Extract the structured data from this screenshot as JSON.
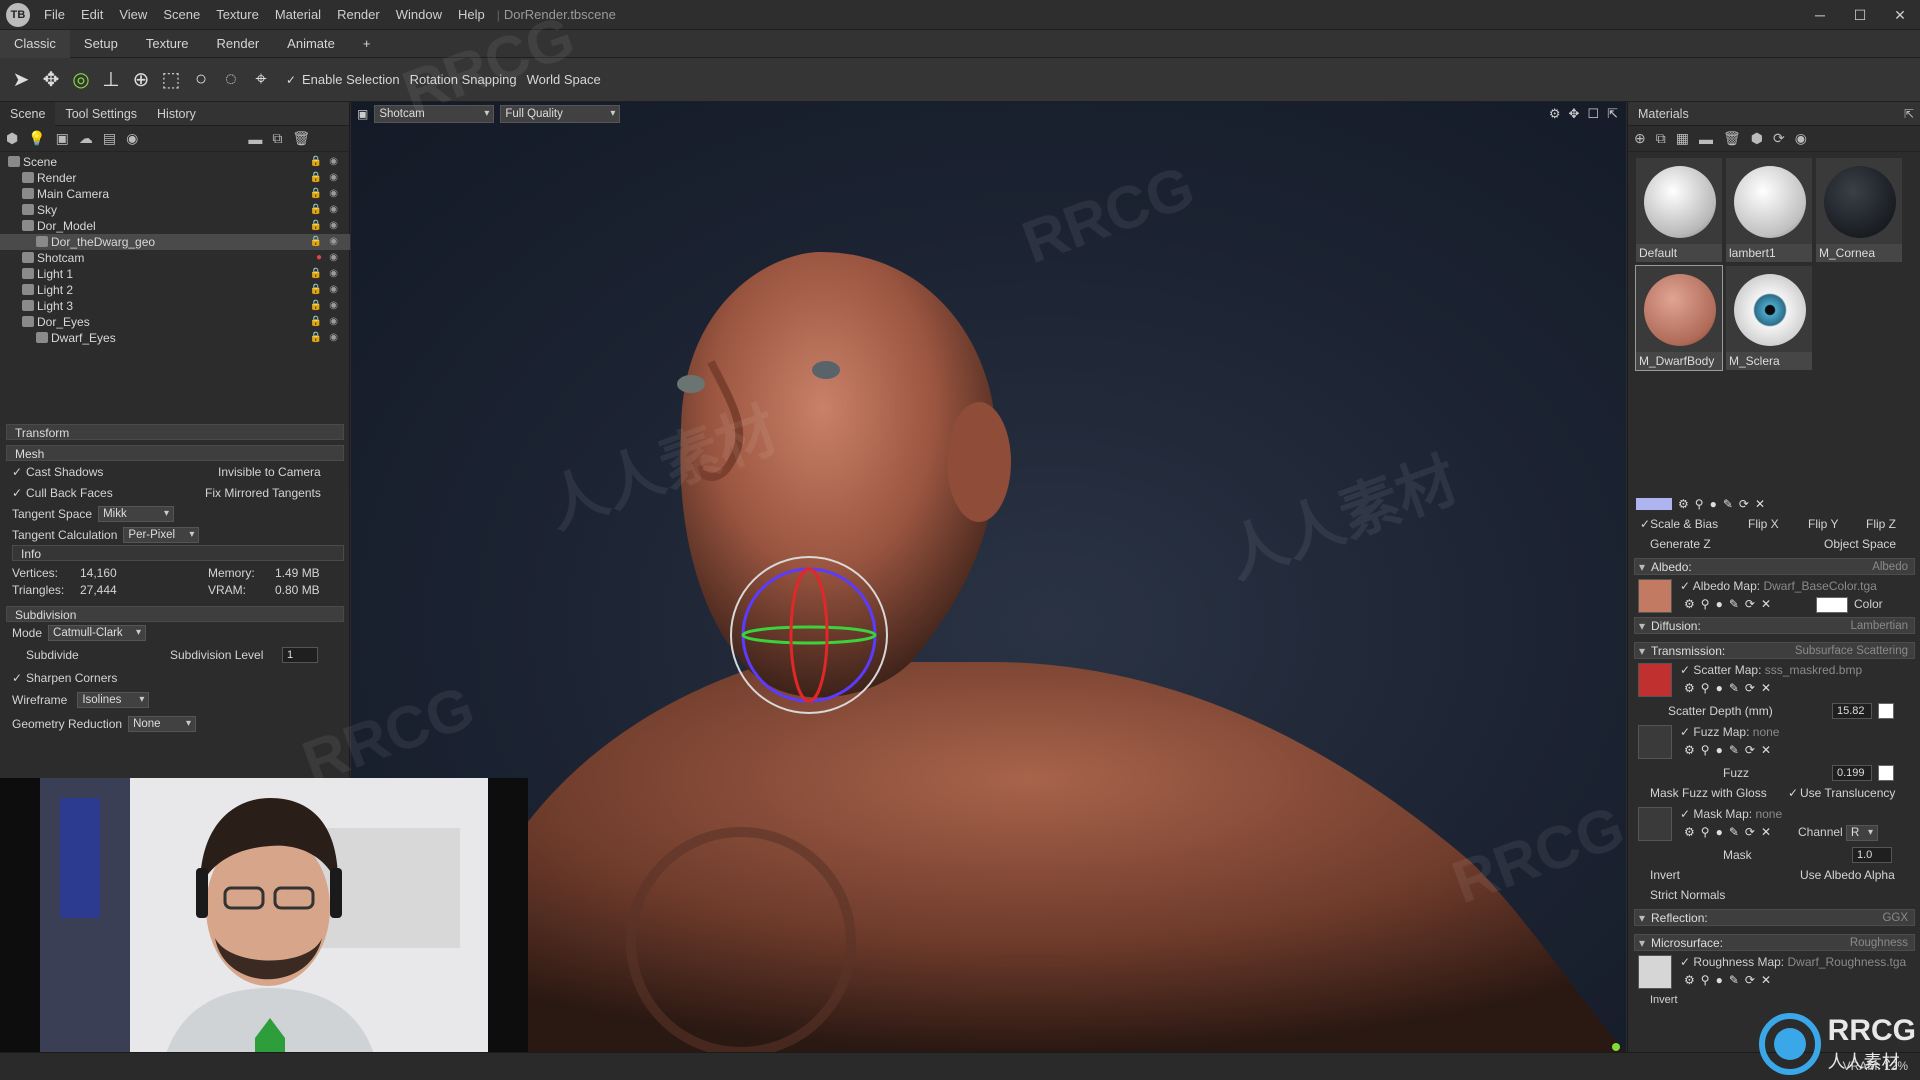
{
  "app": {
    "title": "DorRender.tbscene",
    "logo": "TB"
  },
  "menu": [
    "File",
    "Edit",
    "View",
    "Scene",
    "Texture",
    "Material",
    "Render",
    "Window",
    "Help"
  ],
  "window_controls": {
    "minimize": "─",
    "maximize": "☐",
    "close": "✕"
  },
  "workspace_tabs": [
    "Classic",
    "Setup",
    "Texture",
    "Render",
    "Animate",
    "+"
  ],
  "toolbar": {
    "enable_selection": "Enable Selection",
    "rotation_snapping": "Rotation Snapping",
    "world_space": "World Space",
    "icons": [
      "select-arrow-icon",
      "move-icon",
      "rotate-icon",
      "scale-icon",
      "cage-icon",
      "rect-select-icon",
      "circle-select-icon",
      "lasso-icon",
      "polygon-select-icon"
    ]
  },
  "scene_panel": {
    "tabs": [
      "Scene",
      "Tool Settings",
      "History"
    ],
    "tree": [
      {
        "label": "Scene",
        "indent": 0
      },
      {
        "label": "Render",
        "indent": 1
      },
      {
        "label": "Main Camera",
        "indent": 1
      },
      {
        "label": "Sky",
        "indent": 1
      },
      {
        "label": "Dor_Model",
        "indent": 1
      },
      {
        "label": "Dor_theDwarg_geo",
        "indent": 2,
        "selected": true
      },
      {
        "label": "Shotcam",
        "indent": 1,
        "locked": true
      },
      {
        "label": "Light 1",
        "indent": 1
      },
      {
        "label": "Light 2",
        "indent": 1
      },
      {
        "label": "Light 3",
        "indent": 1
      },
      {
        "label": "Dor_Eyes",
        "indent": 1
      },
      {
        "label": "Dwarf_Eyes",
        "indent": 2
      }
    ]
  },
  "properties": {
    "transform": "Transform",
    "mesh": "Mesh",
    "cast_shadows": "Cast Shadows",
    "invisible_to_camera": "Invisible to Camera",
    "cull_back_faces": "Cull Back Faces",
    "fix_mirrored_tangents": "Fix Mirrored Tangents",
    "tangent_space_label": "Tangent Space",
    "tangent_space_value": "Mikk",
    "tangent_calc_label": "Tangent Calculation",
    "tangent_calc_value": "Per-Pixel",
    "info": "Info",
    "vertices_label": "Vertices:",
    "vertices_value": "14,160",
    "triangles_label": "Triangles:",
    "triangles_value": "27,444",
    "memory_label": "Memory:",
    "memory_value": "1.49 MB",
    "vram_label": "VRAM:",
    "vram_value": "0.80 MB",
    "subdivision": "Subdivision",
    "mode_label": "Mode",
    "mode_value": "Catmull-Clark",
    "subdivide": "Subdivide",
    "subdivision_level_label": "Subdivision Level",
    "subdivision_level_value": "1",
    "sharpen_corners": "Sharpen Corners",
    "wireframe_label": "Wireframe",
    "wireframe_value": "Isolines",
    "geometry_reduction_label": "Geometry Reduction",
    "geometry_reduction_value": "None"
  },
  "viewport": {
    "camera": "Shotcam",
    "quality": "Full Quality"
  },
  "materials": {
    "title": "Materials",
    "items": [
      {
        "name": "Default",
        "color": "#e8e8e8"
      },
      {
        "name": "lambert1",
        "color": "#e2e2e2"
      },
      {
        "name": "M_Cornea",
        "color": "#1e2226"
      },
      {
        "name": "M_DwarfBody",
        "color": "#c98472"
      },
      {
        "name": "M_Sclera",
        "color": "#4aa6c8"
      }
    ],
    "scale_bias": "Scale & Bias",
    "flip_x": "Flip X",
    "flip_y": "Flip Y",
    "flip_z": "Flip Z",
    "generate_z": "Generate Z",
    "object_space": "Object Space",
    "albedo": {
      "section": "Albedo:",
      "type": "Albedo",
      "map_label": "Albedo Map:",
      "map": "Dwarf_BaseColor.tga",
      "color": "Color"
    },
    "diffusion": {
      "section": "Diffusion:",
      "type": "Lambertian"
    },
    "transmission": {
      "section": "Transmission:",
      "type": "Subsurface Scattering",
      "scatter_map_label": "Scatter Map:",
      "scatter_map": "sss_maskred.bmp",
      "scatter_depth_label": "Scatter Depth (mm)",
      "scatter_depth_value": "15.82",
      "fuzz_map_label": "Fuzz Map:",
      "fuzz_map": "none",
      "fuzz_label": "Fuzz",
      "fuzz_value": "0.199",
      "mask_fuzz_gloss": "Mask Fuzz with Gloss",
      "use_translucency": "Use Translucency",
      "mask_map_label": "Mask Map:",
      "mask_map": "none",
      "channel_label": "Channel",
      "channel_value": "R",
      "mask_label": "Mask",
      "mask_value": "1.0",
      "invert": "Invert",
      "use_albedo_alpha": "Use Albedo Alpha",
      "strict_normals": "Strict Normals"
    },
    "reflection": {
      "section": "Reflection:",
      "type": "GGX"
    },
    "microsurface": {
      "section": "Microsurface:",
      "type": "Roughness",
      "roughness_map_label": "Roughness Map:",
      "roughness_map": "Dwarf_Roughness.tga",
      "invert": "Invert"
    }
  },
  "status": {
    "vram": "VRAM: 12%"
  },
  "watermark": {
    "text": "RRCG",
    "cn": "人人素材",
    "badge_text": "RRCG",
    "badge_cn": "人人素材"
  },
  "colors": {
    "accent": "#7fdc3a",
    "selection": "#4a4a4a",
    "skin": "#b56b52"
  }
}
